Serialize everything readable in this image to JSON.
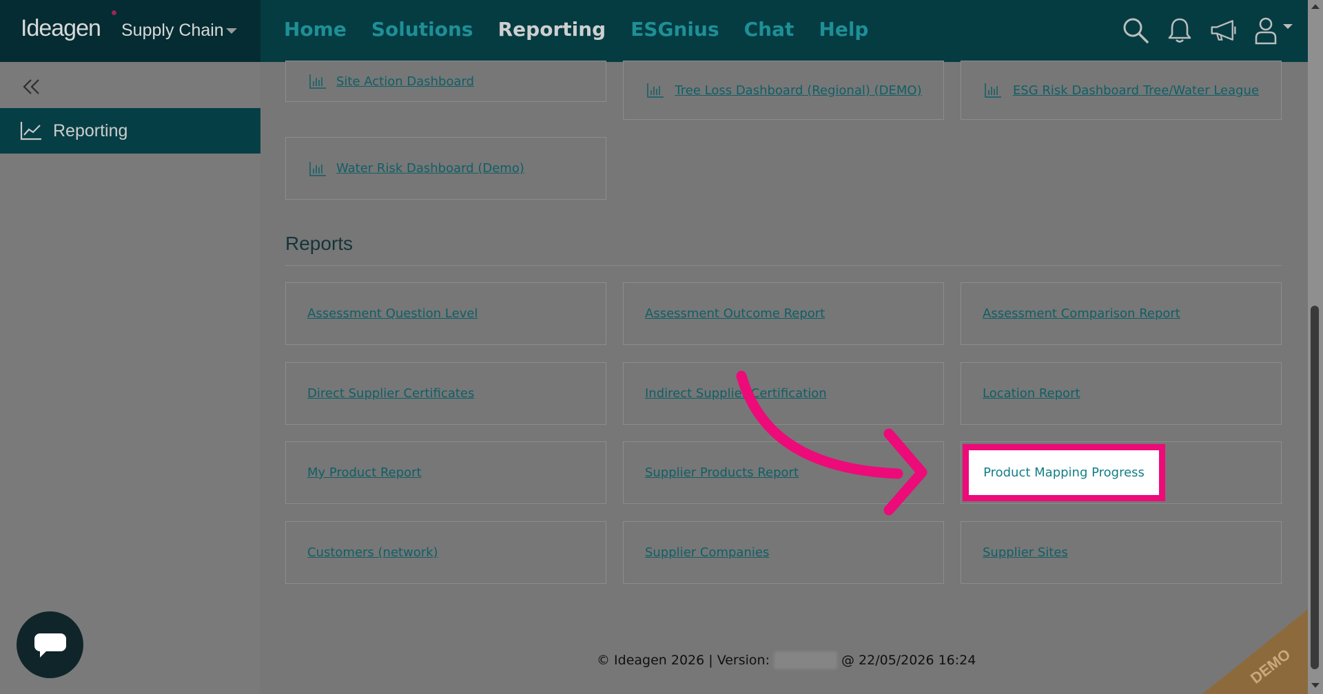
{
  "brand": {
    "name": "Ideagen",
    "product": "Supply Chain"
  },
  "nav": {
    "items": [
      "Home",
      "Solutions",
      "Reporting",
      "ESGnius",
      "Chat",
      "Help"
    ],
    "active": "Reporting"
  },
  "icons": {
    "search": "search-icon",
    "notifications": "bell-icon",
    "announcements": "megaphone-icon",
    "user": "user-icon"
  },
  "sidebar": {
    "collapse": "double-chevron-left-icon",
    "items": [
      {
        "label": "Reporting",
        "icon": "trend-chart-icon"
      }
    ]
  },
  "dashboards": [
    {
      "label": "Site Action Dashboard"
    },
    {
      "label": "Tree Loss Dashboard (Regional) (DEMO)"
    },
    {
      "label": "ESG Risk Dashboard Tree/Water League"
    },
    {
      "label": "Water Risk Dashboard (Demo)"
    }
  ],
  "reports": {
    "title": "Reports",
    "items": [
      "Assessment Question Level",
      "Assessment Outcome Report",
      "Assessment Comparison Report",
      "Direct Supplier Certificates",
      "Indirect Supplier Certification",
      "Location Report",
      "My Product Report",
      "Supplier Products Report",
      "Product Mapping Progress",
      "Customers (network)",
      "Supplier Companies",
      "Supplier Sites"
    ],
    "highlighted": "Product Mapping Progress"
  },
  "footer": {
    "copyright": "© Ideagen 2026 | Version:",
    "timestamp": "@ 22/05/2026 16:24"
  },
  "watermark": "DEMO",
  "colors": {
    "topbar": "#043c42",
    "accent": "#1f8f96",
    "highlight": "#ec0b78",
    "sidebar_active": "#053f45"
  }
}
